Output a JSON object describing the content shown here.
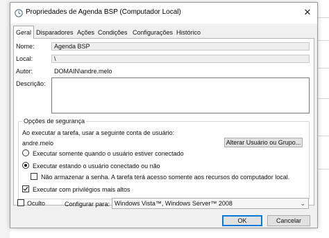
{
  "window": {
    "title": "Propriedades de Agenda BSP (Computador Local)",
    "close_glyph": "✕"
  },
  "tabs": [
    {
      "label": "Geral",
      "active": true
    },
    {
      "label": "Disparadores",
      "active": false
    },
    {
      "label": "Ações",
      "active": false
    },
    {
      "label": "Condições",
      "active": false
    },
    {
      "label": "Configurações",
      "active": false
    },
    {
      "label": "Histórico",
      "active": false
    }
  ],
  "general": {
    "name_label": "Nome:",
    "name_value": "Agenda BSP",
    "location_label": "Local:",
    "location_value": "\\",
    "author_label": "Autor:",
    "author_value": "DOMAIN\\andre.melo",
    "description_label": "Descrição:",
    "description_value": ""
  },
  "security": {
    "legend": "Opções de segurança",
    "run_as_label": "Ao executar a tarefa, usar a seguinte conta de usuário:",
    "account": "andre.melo",
    "change_user_button": "Alterar Usuário ou Grupo...",
    "radio_logged_on": "Executar somente quando o usuário estiver conectado",
    "radio_any": "Executar estando o usuário conectado ou não",
    "selected_radio": "radio_any",
    "no_store_password": "Não armazenar a senha. A tarefa terá acesso somente aos recursos do computador local.",
    "no_store_password_checked": false,
    "highest_privileges": "Executar com privilégios mais altos",
    "highest_privileges_checked": true
  },
  "footer": {
    "hidden_label": "Oculto",
    "hidden_checked": false,
    "configure_label": "Configurar para:",
    "configure_value": "Windows Vista™, Windows Server™ 2008",
    "ok_button": "OK",
    "cancel_button": "Cancelar"
  },
  "colors": {
    "accent": "#0078d7",
    "dialog_bg": "#f0f0f0"
  },
  "icons": {
    "title": "clock-icon",
    "dropdown": "chevron-down-icon",
    "check": "check-icon"
  }
}
